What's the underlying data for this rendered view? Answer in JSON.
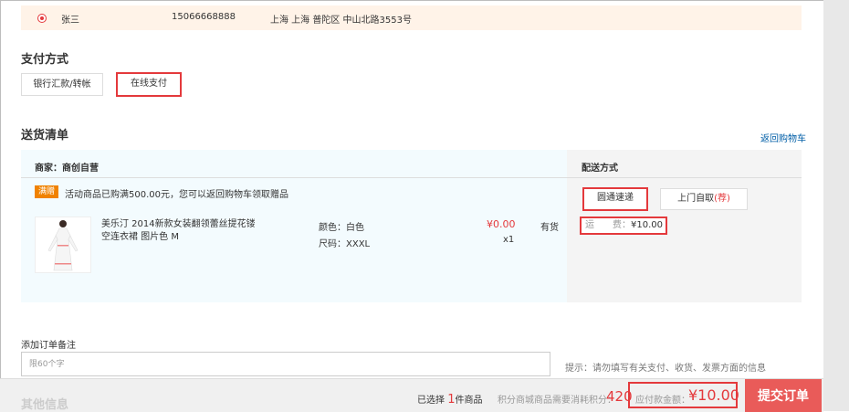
{
  "address": {
    "name": "张三",
    "phone": "15066668888",
    "location": "上海 上海 普陀区   中山北路3553号",
    "selected": true
  },
  "payment": {
    "title": "支付方式",
    "options": [
      "银行汇款/转帐",
      "在线支付"
    ],
    "selected": "在线支付"
  },
  "delivery": {
    "title": "送货清单",
    "back_link": "返回购物车",
    "seller": "商家：商创自营",
    "shipping_header": "配送方式",
    "promo_badge": "满赠",
    "promo_text": "活动商品已购满500.00元，您可以返回购物车领取赠品",
    "product": {
      "name": "美乐汀 2014新款女装翻领蕾丝提花镂空连衣裙 图片色 M",
      "color": "颜色：白色",
      "size": "尺码：XXXL",
      "price": "¥0.00",
      "qty": "x1",
      "stock": "有货"
    },
    "shipping_options": [
      "圆通速递",
      "上门自取"
    ],
    "pickup_tag": "(荐)",
    "fee_label": "运　　费：",
    "fee_value": "¥10.00"
  },
  "remark": {
    "label": "添加订单备注",
    "placeholder": "限60个字",
    "hint": "提示：请勿填写有关支付、收货、发票方面的信息"
  },
  "footer": {
    "other_info": "其他信息",
    "selected_prefix": "已选择",
    "selected_count": "1",
    "selected_suffix": "件商品",
    "points_label": "积分商城商品需要消耗积分：",
    "points_value": "420",
    "total_label": "应付款金额：",
    "total_value": "¥10.00",
    "submit_label": "提交订单"
  },
  "colors": {
    "accent": "#e4393c",
    "submit": "#e95b59",
    "address_bg": "#fff3e8",
    "list_bg": "#f3fbfe"
  },
  "icons": {
    "radio": "radio-selected-icon"
  }
}
